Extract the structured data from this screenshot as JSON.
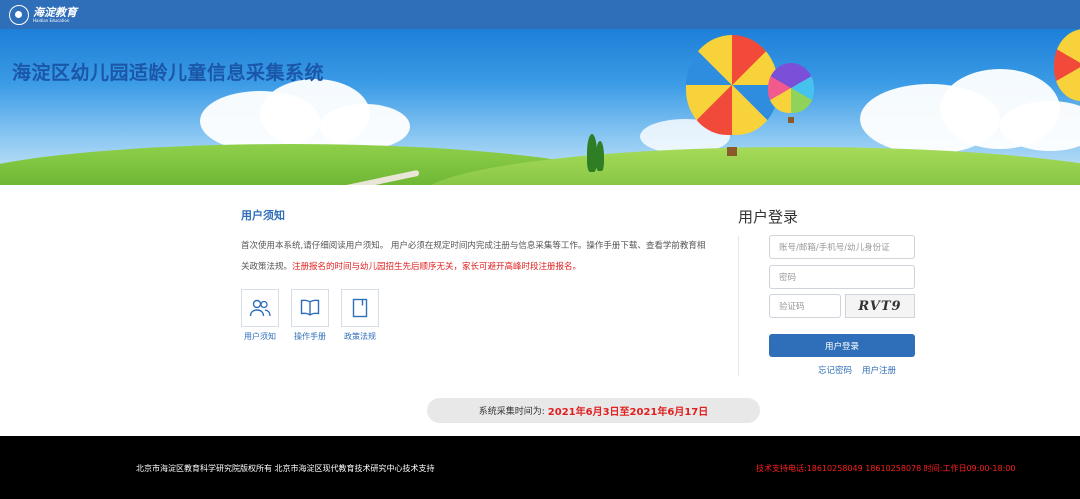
{
  "header": {
    "logo_text": "海淀教育",
    "logo_subtext": "Haidian Education"
  },
  "banner": {
    "title": "海淀区幼儿园适龄儿童信息采集系统"
  },
  "notice": {
    "title": "用户须知",
    "text_normal": "首次使用本系统,请仔细阅读用户须知。 用户必须在规定时间内完成注册与信息采集等工作。操作手册下载、查看学前教育相关政策法规。",
    "text_red": "注册报名的时间与幼儿园招生先后顺序无关，家长可避开高峰时段注册报名。",
    "docs": [
      {
        "label": "用户须知",
        "icon": "users-icon"
      },
      {
        "label": "操作手册",
        "icon": "book-open-icon"
      },
      {
        "label": "政策法规",
        "icon": "document-icon"
      }
    ]
  },
  "login": {
    "title": "用户登录",
    "account_placeholder": "账号/邮箱/手机号/幼儿身份证",
    "password_placeholder": "密码",
    "captcha_placeholder": "验证码",
    "captcha_text": "RVT9",
    "submit_label": "用户登录",
    "forgot_label": "忘记密码",
    "register_label": "用户注册"
  },
  "period": {
    "label": "系统采集时间为:",
    "value": "2021年6月3日至2021年6月17日"
  },
  "footer": {
    "copyright": "北京市海淀区教育科学研究院版权所有 北京市海淀区现代教育技术研究中心技术支持",
    "support": "技术支持电话:18610258049 18610258078 时间:工作日09:00-18:00"
  },
  "colors": {
    "primary": "#2f6fba",
    "alert": "#e02020",
    "footer_bg": "#000000"
  }
}
